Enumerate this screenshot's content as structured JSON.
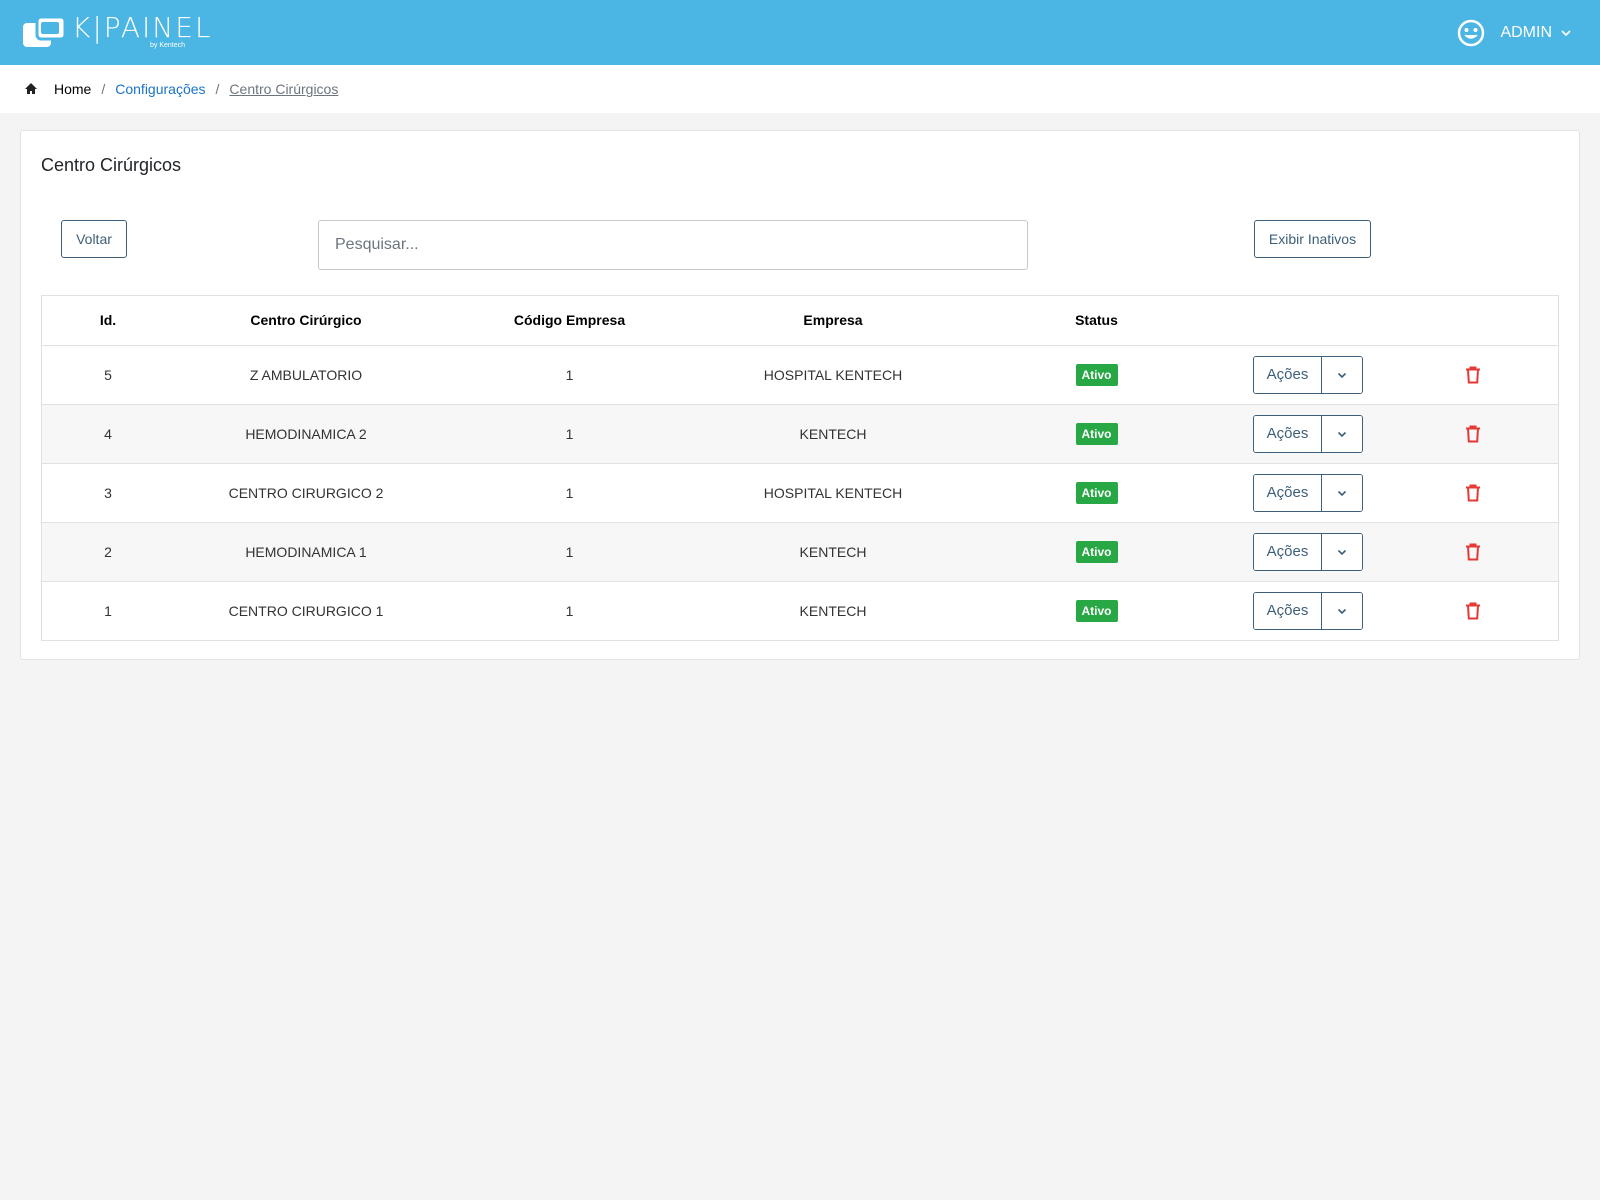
{
  "header": {
    "logo_text": "K|PAINEL",
    "logo_byline": "by Kentech",
    "user_name": "ADMIN",
    "user_icon": "smiley-icon",
    "brand_color": "#4bb5e3"
  },
  "breadcrumb": {
    "home": "Home",
    "sep1": "/",
    "config": "Configurações",
    "sep2": "/",
    "current": "Centro Cirúrgicos"
  },
  "page": {
    "title": "Centro Cirúrgicos",
    "back_label": "Voltar",
    "search_placeholder": "Pesquisar...",
    "show_inactive_label": "Exibir Inativos"
  },
  "table": {
    "columns": [
      "Id.",
      "Centro Cirúrgico",
      "Código Empresa",
      "Empresa",
      "Status"
    ],
    "rows": [
      {
        "id": "5",
        "centro": "Z AMBULATORIO",
        "codigo": "1",
        "empresa": "HOSPITAL KENTECH",
        "status": "Ativo",
        "acoes": "Ações"
      },
      {
        "id": "4",
        "centro": "HEMODINAMICA 2",
        "codigo": "1",
        "empresa": "KENTECH",
        "status": "Ativo",
        "acoes": "Ações"
      },
      {
        "id": "3",
        "centro": "CENTRO CIRURGICO 2",
        "codigo": "1",
        "empresa": "HOSPITAL KENTECH",
        "status": "Ativo",
        "acoes": "Ações"
      },
      {
        "id": "2",
        "centro": "HEMODINAMICA 1",
        "codigo": "1",
        "empresa": "KENTECH",
        "status": "Ativo",
        "acoes": "Ações"
      },
      {
        "id": "1",
        "centro": "CENTRO CIRURGICO 1",
        "codigo": "1",
        "empresa": "KENTECH",
        "status": "Ativo",
        "acoes": "Ações"
      }
    ],
    "status_color": "#28a745",
    "delete_color": "#e53935"
  }
}
